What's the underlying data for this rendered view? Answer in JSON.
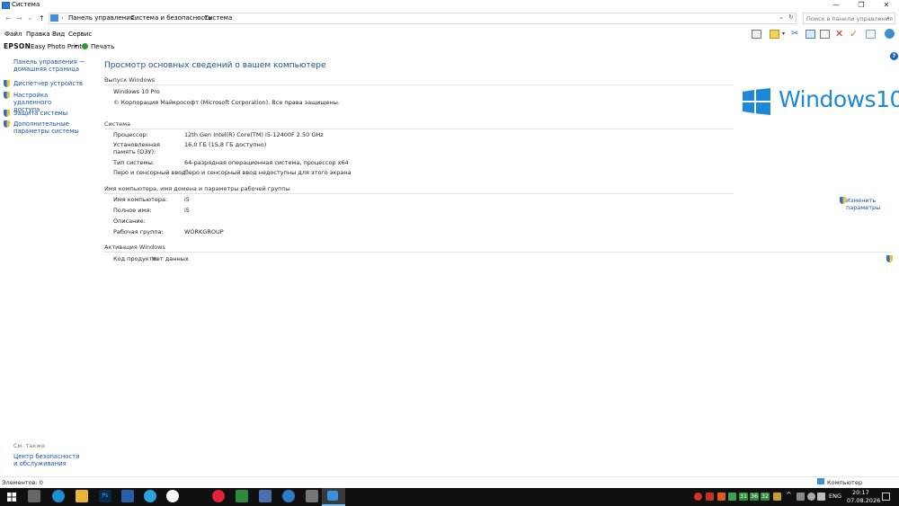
{
  "window": {
    "title": "Система",
    "controls": [
      "—",
      "❐",
      "✕"
    ]
  },
  "nav": {
    "back": "←",
    "forward": "→",
    "recent": "⌄",
    "up": "↑",
    "breadcrumbs": [
      "Панель управления",
      "Система и безопасность",
      "Система"
    ],
    "search_placeholder": "Поиск в панели управления"
  },
  "menu": [
    "Файл",
    "Правка",
    "Вид",
    "Сервис"
  ],
  "epson_bar": {
    "brand": "EPSON",
    "app": "Easy Photo Print",
    "dropdown": "▾",
    "print": "Печать"
  },
  "sidebar": {
    "home": "Панель управления — домашняя страница",
    "items": [
      "Диспетчер устройств",
      "Настройка удаленного доступа",
      "Защита системы",
      "Дополнительные параметры системы"
    ],
    "see_also": "См. также",
    "see_also_link": "Центр безопасности и обслуживания"
  },
  "main": {
    "title": "Просмотр основных сведений о вашем компьютере",
    "edition": {
      "header": "Выпуск Windows",
      "name": "Windows 10 Pro",
      "copyright": "© Корпорация Майкрософт (Microsoft Corporation). Все права защищены."
    },
    "logo_text": "Windows",
    "logo_num": "10",
    "system": {
      "header": "Система",
      "rows": [
        {
          "label": "Процессор:",
          "value": "12th Gen Intel(R) Core(TM) i5-12400F   2.50 GHz"
        },
        {
          "label": "Установленная память (ОЗУ):",
          "value": "16,0 ГБ (15,8 ГБ доступно)"
        },
        {
          "label": "Тип системы:",
          "value": "64-разрядная операционная система, процессор x64"
        },
        {
          "label": "Перо и сенсорный ввод:",
          "value": "Перо и сенсорный ввод недоступны для этого экрана"
        }
      ]
    },
    "computer": {
      "header": "Имя компьютера, имя домена и параметры рабочей группы",
      "rows": [
        {
          "label": "Имя компьютера:",
          "value": "i5"
        },
        {
          "label": "Полное имя:",
          "value": "i5"
        },
        {
          "label": "Описание:",
          "value": ""
        },
        {
          "label": "Рабочая группа:",
          "value": "WORKGROUP"
        }
      ],
      "change": "Изменить параметры"
    },
    "activation": {
      "header": "Активация Windows",
      "label": "Код продукта:",
      "value": "Нет данных"
    }
  },
  "statusbar": {
    "left": "Элементов: 0",
    "right": "Компьютер"
  },
  "taskbar": {
    "lang": "ENG",
    "time": "20:17",
    "date": "07.08.2026",
    "tray_numbers": [
      "31",
      "36",
      "32"
    ],
    "search_app": "Ps"
  },
  "colors": {
    "link": "#1a52a8",
    "title_blue": "#1b4f97",
    "win_blue": "#1e88d8",
    "taskbar": "#101010"
  }
}
